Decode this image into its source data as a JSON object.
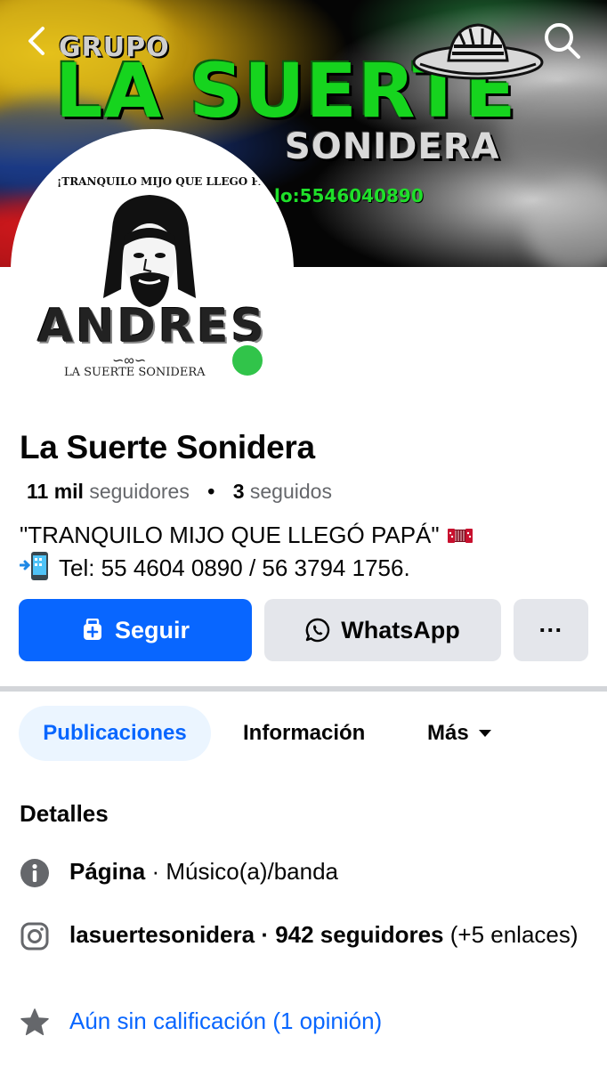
{
  "header": {
    "back_icon": "chevron-left-icon",
    "search_icon": "search-icon"
  },
  "cover": {
    "title_small": "GRUPO",
    "title_big": "LA SUERTE",
    "title_sub": "SONIDERA",
    "phone": "lo:5546040890"
  },
  "avatar": {
    "top_text": "¡TRANQUILO MIJO QUE LLEGO PAPA!",
    "name": "ANDRES",
    "sub_text": "LA SUERTE SONIDERA",
    "status": "online"
  },
  "profile": {
    "name": "La Suerte Sonidera",
    "followers_count": "11 mil",
    "followers_label": "seguidores",
    "separator": "•",
    "following_count": "3",
    "following_label": "seguidos",
    "bio_line1": "\"TRANQUILO MIJO QUE LLEGÓ PAPÁ\"",
    "bio_line2": "Tel: 55 4604 0890 / 56 3794 1756."
  },
  "actions": {
    "follow_label": "Seguir",
    "whatsapp_label": "WhatsApp",
    "more_label": "···"
  },
  "tabs": [
    {
      "label": "Publicaciones",
      "active": true
    },
    {
      "label": "Información",
      "active": false
    },
    {
      "label": "Más",
      "active": false
    }
  ],
  "details": {
    "title": "Detalles",
    "page_label": "Página",
    "page_category": " · Músico(a)/banda",
    "instagram_handle": "lasuertesonidera",
    "instagram_followers": " · 942 seguidores",
    "instagram_extra": " (+5 enlaces)",
    "rating": "Aún sin calificación (1 opinión)"
  },
  "colors": {
    "primary": "#0866ff",
    "secondary_bg": "#e4e6eb",
    "online": "#31c44a",
    "text": "#050505",
    "muted": "#65676b"
  }
}
